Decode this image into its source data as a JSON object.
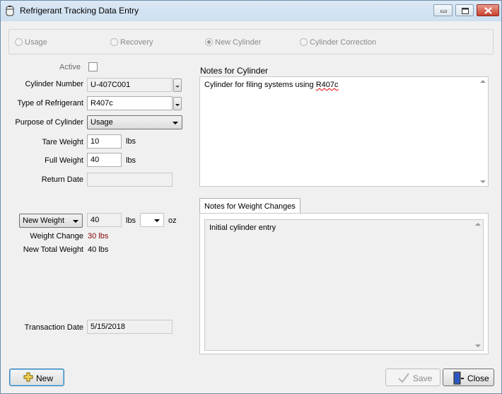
{
  "window": {
    "title": "Refrigerant Tracking Data Entry",
    "controls": [
      "minimize-icon",
      "maximize-icon",
      "close-icon"
    ]
  },
  "modes": {
    "usage": "Usage",
    "recovery": "Recovery",
    "new_cylinder": "New Cylinder",
    "cylinder_correction": "Cylinder Correction",
    "selected": "New Cylinder"
  },
  "form": {
    "active_label": "Active",
    "active_checked": false,
    "cylinder_number_label": "Cylinder Number",
    "cylinder_number": "U-407C001",
    "refrigerant_type_label": "Type of Refrigerant",
    "refrigerant_type": "R407c",
    "purpose_label": "Purpose of Cylinder",
    "purpose": "Usage",
    "tare_weight_label": "Tare Weight",
    "tare_weight": "10",
    "full_weight_label": "Full Weight",
    "full_weight": "40",
    "weight_unit": "lbs",
    "return_date_label": "Return Date",
    "return_date": ""
  },
  "weight": {
    "mode": "New Weight",
    "value": "40",
    "unit_lbs": "lbs",
    "oz_value": "",
    "unit_oz": "oz",
    "change_label": "Weight Change",
    "change_value": "30 lbs",
    "total_label": "New Total Weight",
    "total_value": "40 lbs"
  },
  "transaction": {
    "label": "Transaction Date",
    "date": "5/15/2018"
  },
  "notes_cylinder": {
    "label": "Notes for Cylinder",
    "text_prefix": "Cylinder for filing systems using ",
    "text_flagged": "R407c"
  },
  "notes_weight": {
    "tab_label": "Notes for Weight Changes",
    "text": "Initial cylinder entry"
  },
  "buttons": {
    "new": "New",
    "save": "Save",
    "close": "Close"
  },
  "colors": {
    "weight_change_value": "#8b0000",
    "focus_border": "#3c7fb1"
  }
}
